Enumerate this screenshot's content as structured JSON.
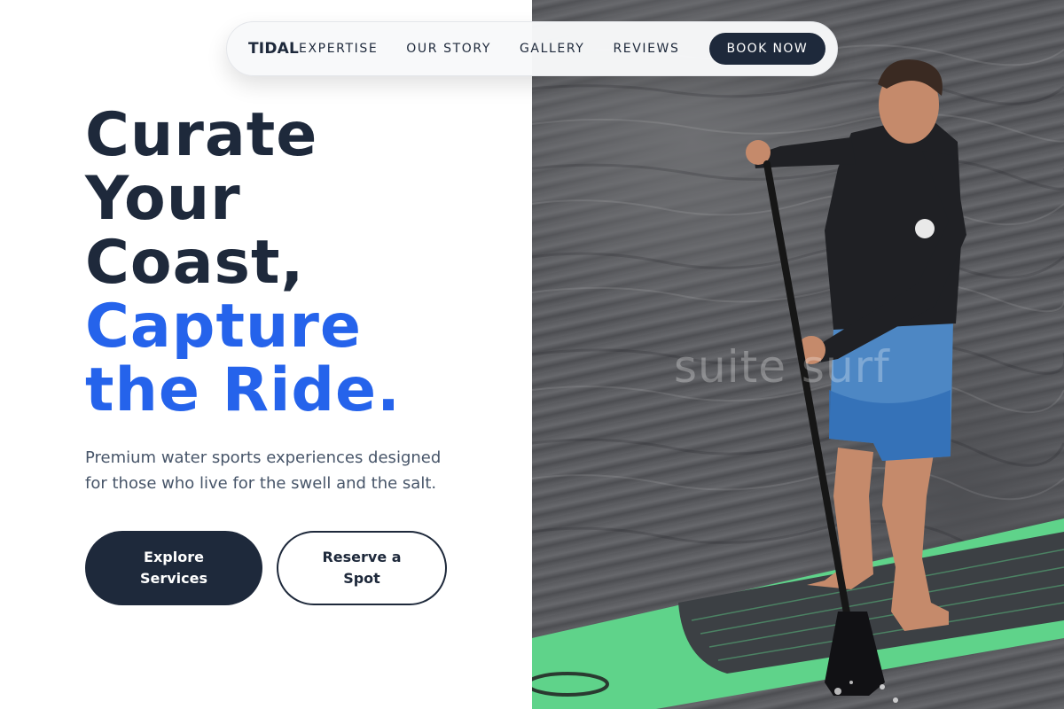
{
  "nav": {
    "brand": "TIDAL",
    "links": [
      "EXPERTISE",
      "OUR STORY",
      "GALLERY",
      "REVIEWS"
    ],
    "cta": "BOOK NOW"
  },
  "hero": {
    "headline_lines": [
      "Curate",
      "Your",
      "Coast,"
    ],
    "accent_lines": [
      "Capture",
      "the Ride."
    ],
    "subtitle": "Premium water sports experiences designed for those who live for the swell and the salt.",
    "primary_button": "Explore Services",
    "secondary_button": "Reserve a Spot"
  },
  "photo": {
    "watermark": "suite surf"
  },
  "colors": {
    "navy": "#1e293b",
    "accent_blue": "#2563eb",
    "text_muted": "#475569",
    "board_green": "#5fd38a"
  }
}
